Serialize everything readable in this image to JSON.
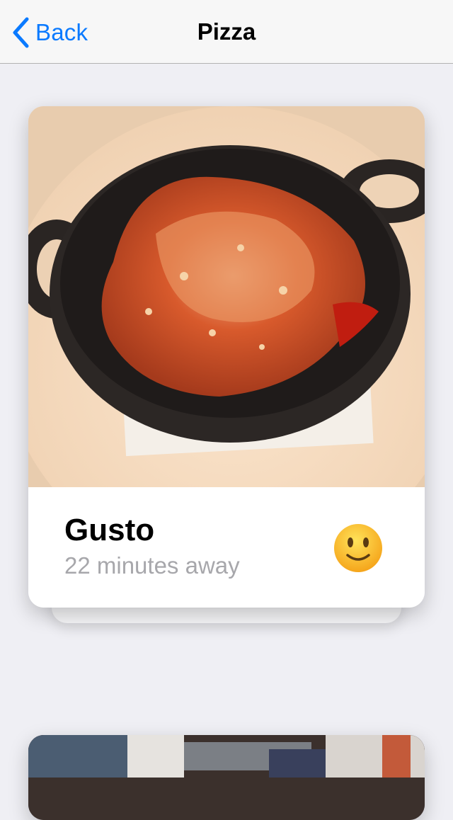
{
  "nav": {
    "back_label": "Back",
    "title": "Pizza"
  },
  "restaurant": {
    "name": "Gusto",
    "distance": "22 minutes away",
    "mood_icon": "slightly-smiling-face-emoji"
  },
  "colors": {
    "accent": "#0a7aff",
    "background": "#efeff4",
    "subtext": "#a7a7ab"
  }
}
